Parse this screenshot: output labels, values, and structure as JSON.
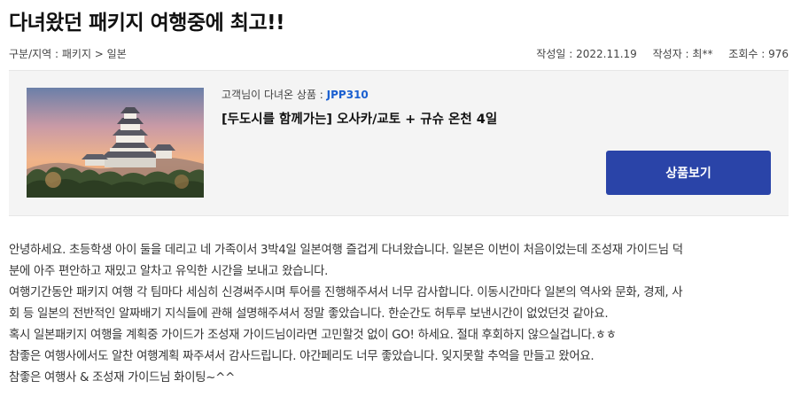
{
  "post": {
    "title": "다녀왔던 패키지 여행중에 최고!!",
    "breadcrumb": "구분/지역 : 패키지 > 일본",
    "date_label": "작성일 : 2022.11.19",
    "author_label": "작성자 : 최**",
    "views_label": "조회수 : 976"
  },
  "product": {
    "code_prefix": "고객님이 다녀온 상품 : ",
    "code": "JPP310",
    "name": "[두도시를 함께가는] 오사카/교토 + 규슈 온천 4일",
    "button_label": "상품보기",
    "image_subject": "himeji-castle-sunset"
  },
  "review": {
    "lines": [
      "안녕하세요. 초등학생 아이 둘을 데리고 네 가족이서 3박4일 일본여행 즐겁게 다녀왔습니다. 일본은 이번이 처음이었는데 조성재 가이드님 덕",
      "분에 아주 편안하고 재밌고 알차고 유익한 시간을 보내고 왔습니다.",
      "여행기간동안 패키지 여행 각 팀마다 세심히 신경써주시며 투어를 진행해주셔서 너무 감사합니다. 이동시간마다 일본의 역사와 문화, 경제, 사",
      "회 등 일본의 전반적인 알짜배기 지식들에 관해 설명해주셔서 정말 좋았습니다. 한순간도 허투루 보낸시간이 없었던것 같아요.",
      "혹시 일본패키지 여행을 계획중 가이드가 조성재 가이드님이라면 고민할것 없이 GO! 하세요. 절대 후회하지 않으실겁니다.ㅎㅎ",
      "참좋은 여행사에서도 알찬 여행계획 짜주셔서 감사드립니다. 야간페리도 너무 좋았습니다. 잊지못할 추억을 만들고 왔어요.",
      "참좋은 여행사 & 조성재 가이드님 화이팅~^^"
    ]
  },
  "colors": {
    "button": "#2a44a8",
    "code": "#1a5fd0",
    "box_bg": "#f4f4f4"
  }
}
